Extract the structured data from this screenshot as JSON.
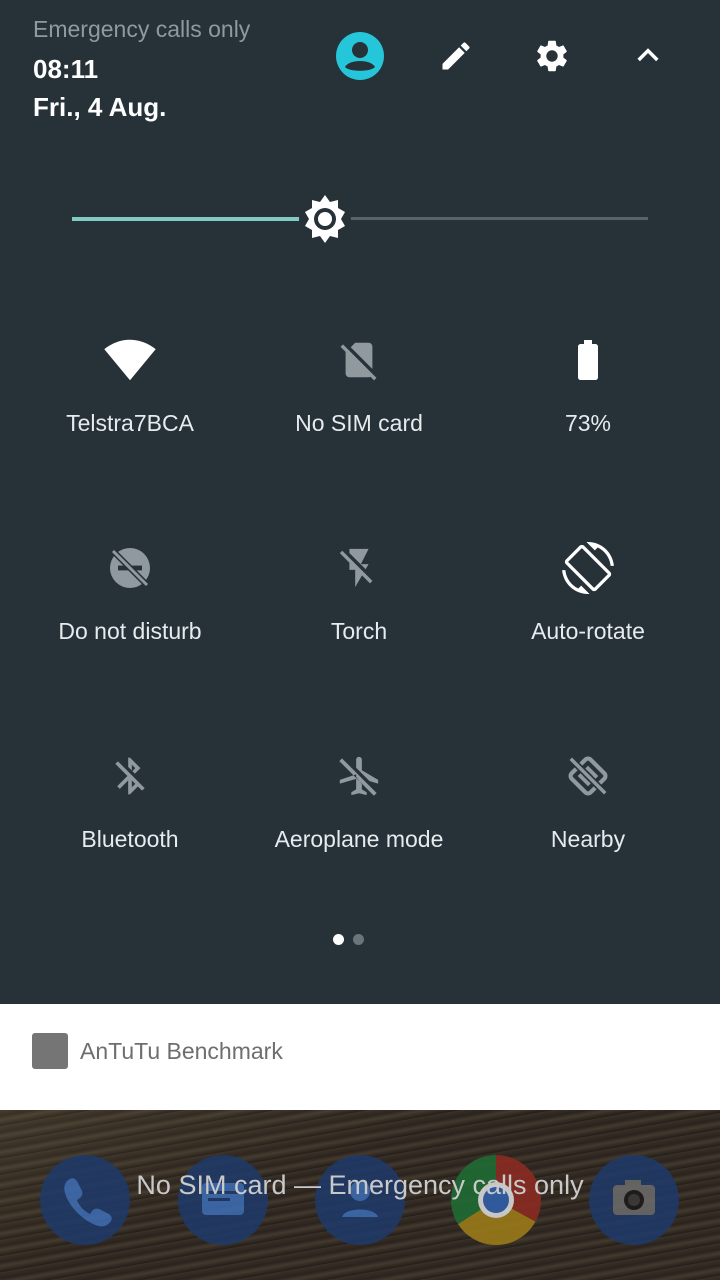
{
  "status": {
    "carrier_text": "Emergency calls only",
    "time": "08:11",
    "date": "Fri., 4 Aug."
  },
  "header_icons": [
    "account-icon",
    "edit-icon",
    "settings-icon",
    "collapse-chevron-icon"
  ],
  "brightness": {
    "level": 0.44
  },
  "tiles": [
    {
      "label": "Telstra7BCA",
      "icon": "wifi-icon",
      "active": true
    },
    {
      "label": "No SIM card",
      "icon": "no-sim-icon",
      "active": false
    },
    {
      "label": "73%",
      "icon": "battery-icon",
      "active": true
    },
    {
      "label": "Do not disturb",
      "icon": "do-not-disturb-icon",
      "active": false
    },
    {
      "label": "Torch",
      "icon": "torch-icon",
      "active": false
    },
    {
      "label": "Auto-rotate",
      "icon": "auto-rotate-icon",
      "active": true
    },
    {
      "label": "Bluetooth",
      "icon": "bluetooth-off-icon",
      "active": false
    },
    {
      "label": "Aeroplane mode",
      "icon": "aeroplane-icon",
      "active": false
    },
    {
      "label": "Nearby",
      "icon": "nearby-icon",
      "active": false
    }
  ],
  "page_indicator": {
    "pages": 2,
    "current": 1
  },
  "notification": {
    "title": "AnTuTu Benchmark"
  },
  "lockscreen": {
    "message": "No SIM card — Emergency calls only"
  },
  "colors": {
    "panel_bg": "#263238",
    "accent": "#80cbc4",
    "account": "#26c6da"
  }
}
